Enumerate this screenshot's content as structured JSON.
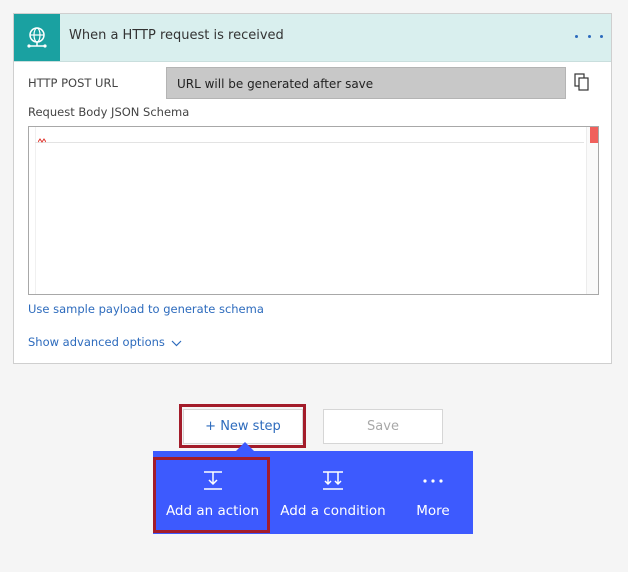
{
  "trigger": {
    "title": "When a HTTP request is received",
    "icon": "globe-network-icon",
    "menu_icon": "ellipsis-icon"
  },
  "fields": {
    "post_url_label": "HTTP POST URL",
    "post_url_value": "URL will be generated after save",
    "copy_icon": "copy-icon",
    "schema_label": "Request Body JSON Schema"
  },
  "links": {
    "sample_payload": "Use sample payload to generate schema",
    "advanced_options": "Show advanced options"
  },
  "buttons": {
    "new_step": "+ New step",
    "save": "Save"
  },
  "step_menu": {
    "items": [
      {
        "label": "Add an action",
        "icon": "add-action-icon"
      },
      {
        "label": "Add a condition",
        "icon": "add-condition-icon"
      },
      {
        "label": "More",
        "icon": "more-icon"
      }
    ]
  },
  "colors": {
    "accent": "#3d5afe",
    "trigger_teal": "#1aa1a1",
    "header_bg": "#d9efee",
    "link": "#2d6bbd",
    "highlight": "#a31c2a"
  }
}
